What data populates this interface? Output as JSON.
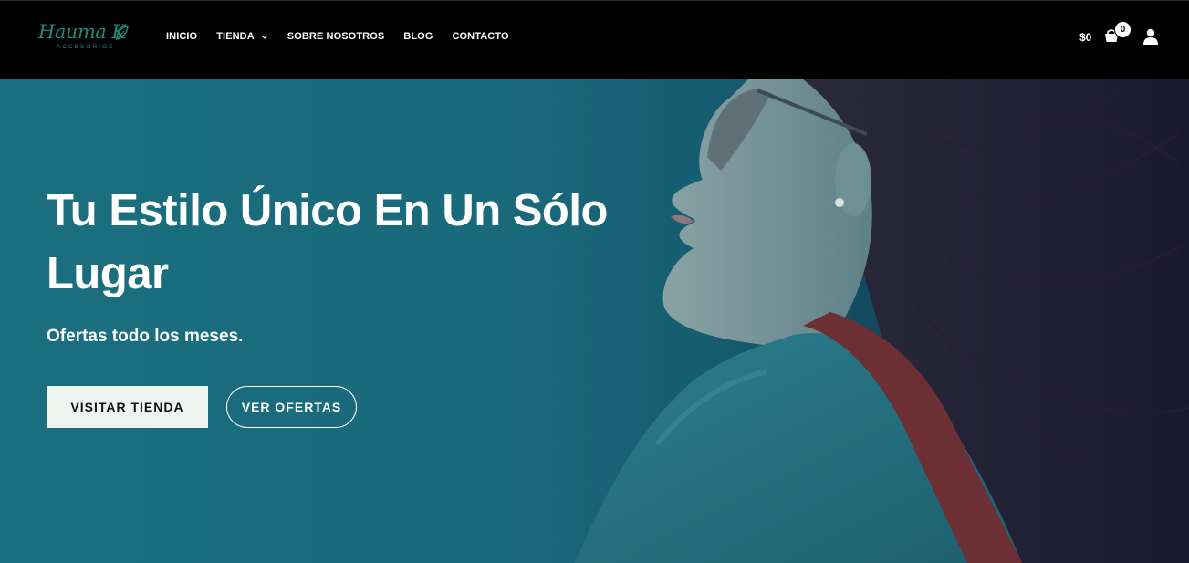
{
  "brand": {
    "script": "Hauma K",
    "subtitle": "ACCESORIOS",
    "color": "#1f8a7c"
  },
  "nav": {
    "items": [
      {
        "label": "INICIO"
      },
      {
        "label": "TIENDA",
        "has_dropdown": true
      },
      {
        "label": "SOBRE NOSOTROS"
      },
      {
        "label": "BLOG"
      },
      {
        "label": "CONTACTO"
      }
    ]
  },
  "cart": {
    "total": "$0",
    "count": "0",
    "icon": "shopping-bag-icon"
  },
  "account": {
    "icon": "user-icon"
  },
  "hero": {
    "title": "Tu Estilo Único En Un Sólo Lugar",
    "subtitle": "Ofertas todo los meses.",
    "primary_button": "VISITAR TIENDA",
    "secondary_button": "VER OFERTAS",
    "overlay_color": "#1a6f7e",
    "button_bg": "#eef5f1"
  }
}
